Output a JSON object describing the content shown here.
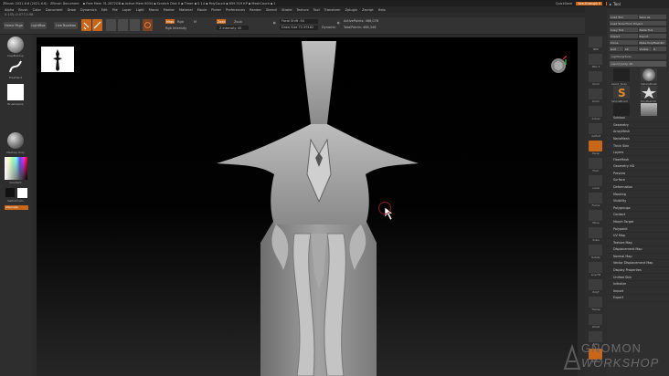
{
  "titlebar": {
    "title": "ZBrush 2021.6.6 (2021.6.6) · ZBrush Document",
    "mem": "▪ Free Mem 31.2872GB ▪ Active Mem 6034 ▪ Scratch Disk 0 ▪ Timer ▪ 0.14 ▪ PolyCount ▪ 659.519 KP ▪ MeshCount ▪ 1",
    "quicksave": "QuickSave",
    "see_through": "See-through 0",
    "menus_label": "Menus",
    "defaultzscript": "DefaultZScript"
  },
  "menubar": {
    "items": [
      "Alpha",
      "Brush",
      "Color",
      "Document",
      "Draw",
      "Dynamics",
      "Edit",
      "File",
      "Layer",
      "Light",
      "Macro",
      "Marker",
      "Material",
      "Movie",
      "Picker",
      "Preferences",
      "Render",
      "Stencil",
      "Stroke",
      "Texture",
      "Tool",
      "Transform",
      "Zplugin",
      "Zscript",
      "Help"
    ]
  },
  "coords": "0.135,-0.077,0.96",
  "toolbar": {
    "home_page": "Home Page",
    "lightbox": "LightBox",
    "live_boolean": "Live Boolean",
    "edit": "Edit",
    "draw": "Draw",
    "move": "Move",
    "scale": "Scale",
    "rotate": "Rotate",
    "mrgb": "Mrgb",
    "rgb": "Rgb",
    "m": "M",
    "zadd": "Zadd",
    "zsub": "Zsub",
    "rgb_intensity": "Rgb Intensity",
    "z_intensity": "Z Intensity 45",
    "focal_shift": "Focal Shift -94",
    "draw_size": "Draw Size 72.59182",
    "dynamic": "Dynamic",
    "active_points": "ActivePoints: 466,078",
    "total_points": "TotalPoints: 466,346"
  },
  "leftshelf": {
    "brush_label": "ClayBuildup",
    "stroke_label": "FreeHand",
    "alpha_label": "BrushAlpha",
    "material_label": "MatCap Gray",
    "gradient_label": "Gradient",
    "switch_color": "SwitchColor",
    "alternate": "Alternate"
  },
  "rightshelf": {
    "labels": [
      "BPR",
      "SPix 3",
      "Scroll",
      "Zoom",
      "Actual",
      "AAHalf",
      "Persp",
      "Floor",
      "Local",
      "Frame",
      "Move",
      "Scale",
      "Rotate",
      "Line Fill",
      "PolyF",
      "Transp",
      "Ghost",
      "Solo",
      "Xpose"
    ]
  },
  "tray": {
    "title": "Tool",
    "buttons_row1": [
      "Load Tool",
      "Save As"
    ],
    "buttons_row2": [
      "Load Tools From Project"
    ],
    "buttons_row3": [
      "Copy Tool",
      "Paste Tool"
    ],
    "buttons_row4": [
      "Import",
      "Export"
    ],
    "buttons_row5": [
      "Clone",
      "Make PolyMesh3D"
    ],
    "buttons_row6": [
      "GoZ",
      "All",
      "Visible",
      "R"
    ],
    "lightbox_tools": "Lightbox▸Tools",
    "subtool_name": "sword_body. 48",
    "thumb_labels": [
      "sword_body",
      "SphereBrush",
      "PolyMesh3D",
      "Star",
      "SimpleBrush",
      "Cylinder3D",
      "sword_body"
    ],
    "menu": [
      "Subtool",
      "Geometry",
      "ArrayMesh",
      "NanoMesh",
      "Thick Skin",
      "Layers",
      "FiberMesh",
      "Geometry HD",
      "Preview",
      "Surface",
      "Deformation",
      "Masking",
      "Visibility",
      "Polygroups",
      "Contact",
      "Morph Target",
      "Polypaint",
      "UV Map",
      "Texture Map",
      "Displacement Map",
      "Normal Map",
      "Vector Displacement Map",
      "Display Properties",
      "Unified Skin",
      "Initialize",
      "Import",
      "Export"
    ]
  },
  "watermark": {
    "line1": "GNOMON",
    "line2": "WORKSHOP"
  },
  "colors": {
    "accent": "#c8661a",
    "ui_dark": "#2b2b2b",
    "model_gray": "#9a9a9a"
  }
}
